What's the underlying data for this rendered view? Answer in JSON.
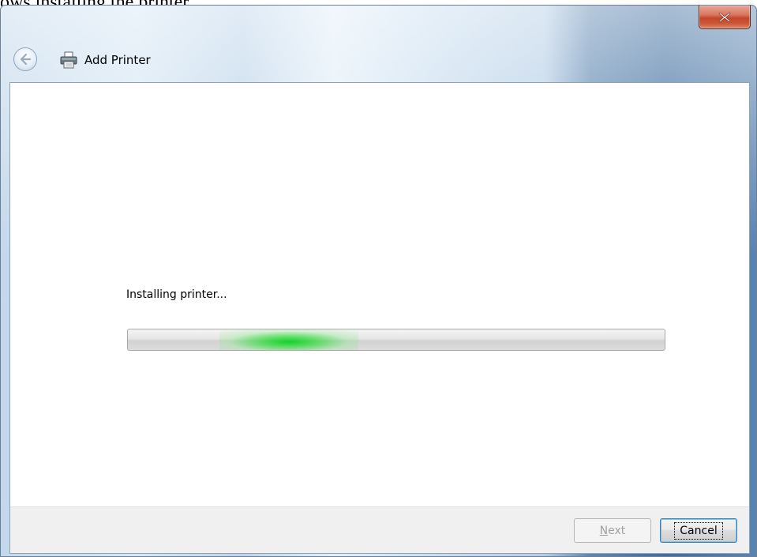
{
  "caption": "ows installing the printer.",
  "window": {
    "title": "Add Printer",
    "close_symbol": "x"
  },
  "content": {
    "status": "Installing printer...",
    "progress": {
      "style": "indeterminate-marquee",
      "glow_start": 0.17,
      "glow_end": 0.43,
      "color": "#22d33a"
    }
  },
  "buttons": {
    "next_mnemonic": "N",
    "next_rest": "ext",
    "next_enabled": false,
    "cancel_label": "Cancel"
  },
  "icons": {
    "close": "close-icon",
    "back": "back-arrow-icon",
    "printer": "printer-icon"
  },
  "colors": {
    "close_red": "#c4452a",
    "focus_border": "#3c7fb1",
    "disabled_text": "#a0a0a0"
  }
}
